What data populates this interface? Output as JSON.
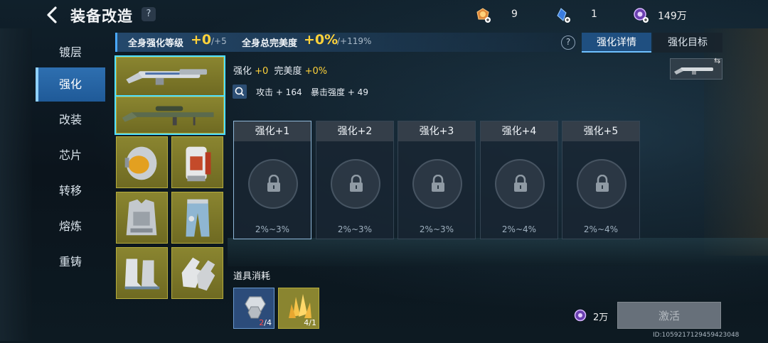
{
  "header": {
    "title": "装备改造",
    "help": "?"
  },
  "currencies": [
    {
      "icon": "medal-icon",
      "value": "9"
    },
    {
      "icon": "blue-crystal-icon",
      "value": "1"
    },
    {
      "icon": "purple-coin-icon",
      "value": "149万"
    }
  ],
  "sidebar": {
    "items": [
      {
        "label": "镀层"
      },
      {
        "label": "强化",
        "active": true
      },
      {
        "label": "改装"
      },
      {
        "label": "芯片"
      },
      {
        "label": "转移"
      },
      {
        "label": "熔炼"
      },
      {
        "label": "重铸"
      }
    ]
  },
  "stats": {
    "level_label": "全身强化等级",
    "level_value": "+0",
    "level_max": "/+5",
    "perfection_label": "全身总完美度",
    "perfection_value": "+0%",
    "perfection_max": "/+119%"
  },
  "tabs": {
    "help": "?",
    "details": "强化详情",
    "target": "强化目标"
  },
  "detail": {
    "enhance_label": "强化",
    "enhance_value": "+0",
    "perfection_label": "完美度",
    "perfection_value": "+0%",
    "attack": "攻击 + 164",
    "crit": "暴击强度 + 49"
  },
  "cards": [
    {
      "label": "强化+1",
      "range": "2%~3%"
    },
    {
      "label": "强化+2",
      "range": "2%~3%"
    },
    {
      "label": "强化+3",
      "range": "2%~3%"
    },
    {
      "label": "强化+4",
      "range": "2%~4%"
    },
    {
      "label": "强化+5",
      "range": "2%~4%"
    }
  ],
  "consume": {
    "title": "道具消耗",
    "items": [
      {
        "icon": "metal-cube-icon",
        "have": "2",
        "need": "/4"
      },
      {
        "icon": "gold-crystal-icon",
        "count": "4/1"
      }
    ]
  },
  "cost": {
    "icon": "purple-coin-icon",
    "value": "2万"
  },
  "activate_label": "激活",
  "id_text": "ID:1059217129459423048",
  "colors": {
    "accent": "#ffd23a",
    "active_tab": "#1f4f80",
    "slot": "#8a8530"
  }
}
